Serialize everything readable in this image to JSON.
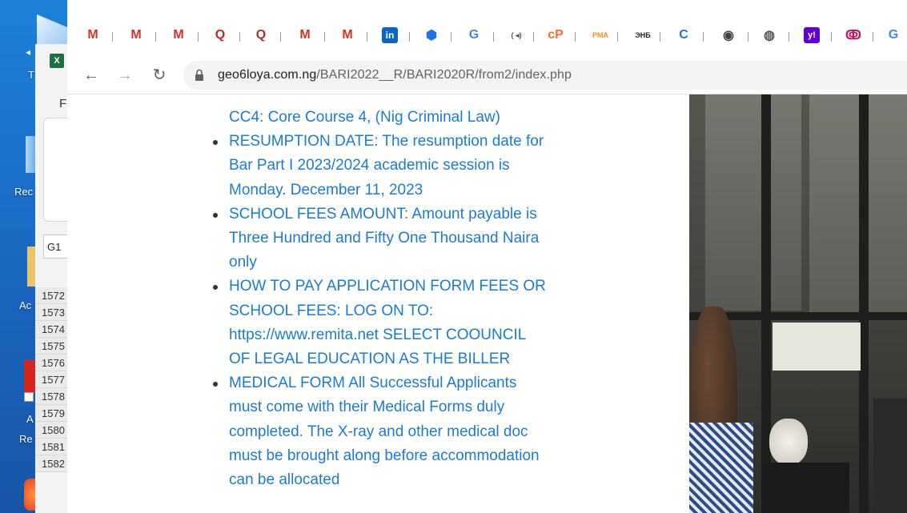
{
  "desktop": {
    "labels": [
      "T",
      "Rec",
      "Ac",
      "A",
      "Re"
    ]
  },
  "excel": {
    "badge": "X",
    "fi_text": "Fi",
    "namebox_value": "G1",
    "row_numbers": [
      "1572",
      "1573",
      "1574",
      "1575",
      "1576",
      "1577",
      "1578",
      "1579",
      "1580",
      "1581",
      "1582"
    ]
  },
  "bookmarks": [
    {
      "icon": "gmail-icon",
      "glyph": "M",
      "color": "#d93025"
    },
    {
      "icon": "gmail-icon",
      "glyph": "M",
      "color": "#d93025"
    },
    {
      "icon": "gmail-icon",
      "glyph": "M",
      "color": "#d93025"
    },
    {
      "icon": "quora-icon",
      "glyph": "Q",
      "color": "#b92b27"
    },
    {
      "icon": "quora-icon",
      "glyph": "Q",
      "color": "#b92b27"
    },
    {
      "icon": "gmail-icon",
      "glyph": "M",
      "color": "#d93025"
    },
    {
      "icon": "gmail-icon",
      "glyph": "M",
      "color": "#d93025"
    },
    {
      "icon": "linkedin-icon",
      "glyph": "in",
      "color": "#0a66c2"
    },
    {
      "icon": "hexagon-icon",
      "glyph": "⬢",
      "color": "#1a73e8"
    },
    {
      "icon": "google-icon",
      "glyph": "G",
      "color": "#4285f4"
    },
    {
      "icon": "audio-icon",
      "glyph": "( ◂)",
      "color": "#555555"
    },
    {
      "icon": "cpanel-icon",
      "glyph": "cP",
      "color": "#ff6c2c"
    },
    {
      "icon": "pma-icon",
      "glyph": "PMA",
      "color": "#f29111"
    },
    {
      "icon": "bank-icon",
      "glyph": "ЭНБ",
      "color": "#222222"
    },
    {
      "icon": "c-logo-icon",
      "glyph": "C",
      "color": "#1a73e8"
    },
    {
      "icon": "shield-icon",
      "glyph": "◉",
      "color": "#444444"
    },
    {
      "icon": "globe-icon",
      "glyph": "◍",
      "color": "#555555"
    },
    {
      "icon": "yahoo-icon",
      "glyph": "y!",
      "color": "#6001d2"
    },
    {
      "icon": "circles-icon",
      "glyph": "ↂ",
      "color": "#c2185b"
    },
    {
      "icon": "google-icon",
      "glyph": "G",
      "color": "#4285f4"
    }
  ],
  "toolbar": {
    "url_host": "geo6loya.com.ng",
    "url_path": "/BARI2022__R/BARI2020R/from2/index.php"
  },
  "page": {
    "items": [
      {
        "bullet": false,
        "lines": [
          "CC4: Core Course 4, (Nig Criminal Law)"
        ]
      },
      {
        "bullet": true,
        "lines": [
          "RESUMPTION DATE: The resumption date for",
          "Bar Part I 2023/2024 academic session is",
          "Monday. December 11, 2023"
        ]
      },
      {
        "bullet": true,
        "lines": [
          "SCHOOL FEES AMOUNT: Amount payable is",
          "Three Hundred and Fifty One Thousand Naira",
          "only"
        ]
      },
      {
        "bullet": true,
        "lines": [
          "HOW TO PAY APPLICATION FORM FEES OR",
          "SCHOOL FEES: LOG ON TO:",
          "https://www.remita.net SELECT COOUNCIL",
          "OF LEGAL EDUCATION AS THE BILLER"
        ]
      },
      {
        "bullet": true,
        "lines": [
          "MEDICAL FORM All Successful Applicants",
          "must come with their Medical Forms duly",
          "completed. The X-ray and other medical doc",
          "must be brought along before accommodation",
          "can be allocated"
        ]
      }
    ]
  }
}
